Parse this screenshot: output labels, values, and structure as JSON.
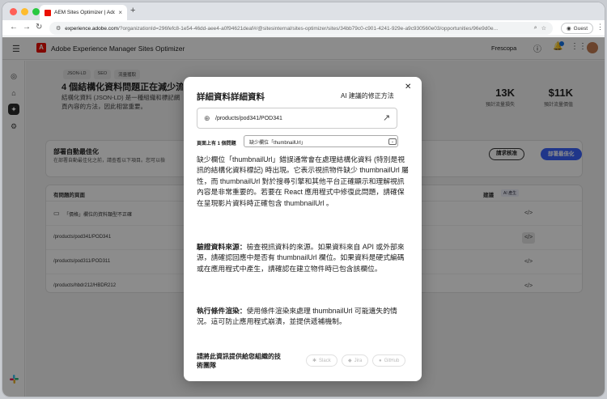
{
  "browser": {
    "tab_title": "AEM Sites Optimizer | Adob",
    "tab_close": "×",
    "new_tab": "+",
    "url_domain": "experience.adobe.com",
    "url_path": "/?organizationId=296fefc8-1e54-46dd-aee4-a0f94621deaf#/@sitesinternal/sites-optimizer/sites/34bb79c0-c901-4241-929e-a9c930560e03/opportunities/96e9d0e...",
    "guest_label": "Guest"
  },
  "app": {
    "title": "Adobe Experience Manager Sites Optimizer",
    "org": "Frescopa"
  },
  "page": {
    "badges": [
      "JSON-LD",
      "SEO",
      "流量獲取"
    ],
    "heading": "4 個結構化資料問題正在減少流量",
    "description": "結構化資料 (JSON-LD) 是一種組織和標記網頁內容的方法，因此相當重要。",
    "stats": [
      {
        "value": "13K",
        "label": "預計流量損失"
      },
      {
        "value": "$11K",
        "label": "預計流量價值"
      }
    ]
  },
  "autofix_card": {
    "title": "部署自動最佳化",
    "subtitle": "在部署自動最佳化之前，請查看以下項目。您可以檢",
    "review_button": "請求核准",
    "deploy_button": "部署最佳化"
  },
  "issues_card": {
    "header_label": "有問題的頁面",
    "header_suggestion": "建議",
    "ai_badge": "AI 產生",
    "rows": [
      {
        "text": "「價格」欄位的資料類型不正確"
      },
      {
        "text": "/products/pod341/POD341"
      },
      {
        "text": "/products/pod311/POD311"
      },
      {
        "text": "/products/hbdr212/HBDR212"
      }
    ],
    "code_icon": "</>"
  },
  "dialog": {
    "title": "詳細資料詳細資料",
    "ai_tab": "AI 建議的修正方法",
    "close": "✕",
    "url": "/products/pod341/POD341",
    "issue_label": "頁面上有 1 個問題",
    "issue_selected": "缺少欄位「thumbnailUrl」",
    "paragraph1": "缺少欄位「thumbnailUrl」錯誤通常會在處理結構化資料 (特別是視訊的結構化資料標記) 時出現。它表示視訊物件缺少 thumbnailUrl 屬性，而 thumbnailUrl 對於搜尋引擎和其他平台正確顯示和理解視訊內容是非常重要的。若要在 React 應用程式中修復此問題，請確保在呈現影片資料時正確包含 thumbnailUrl 。",
    "paragraph2_bold": "驗證資料來源：",
    "paragraph2": "檢查視訊資料的來源。如果資料來自 API 或外部來源，請確認回應中是否有 thumbnailUrl 欄位。如果資料是硬式編碼或在應用程式中產生，請確認在建立物件時已包含該欄位。",
    "paragraph3_bold": "執行條件渲染：",
    "paragraph3": "使用條件渲染來處理 thumbnailUrl 可能遺失的情況。這可防止應用程式崩潰，並提供遞補機制。",
    "share_label": "請將此資訊提供給您組織的技術團隊",
    "share_buttons": [
      "Slack",
      "Jira",
      "GitHub"
    ]
  }
}
